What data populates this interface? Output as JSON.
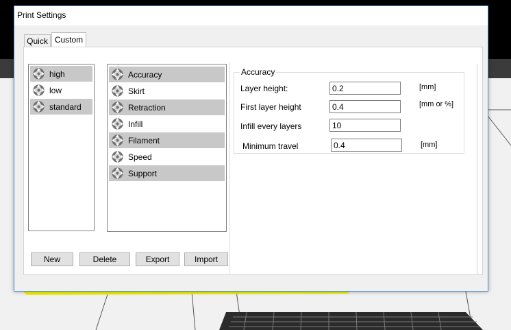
{
  "dialog": {
    "title": "Print Settings",
    "tabs": [
      {
        "label": "Quick",
        "selected": false
      },
      {
        "label": "Custom",
        "selected": true
      }
    ]
  },
  "profiles": [
    {
      "label": "high",
      "icon": "move-arrows-icon"
    },
    {
      "label": "low",
      "icon": "move-arrows-icon"
    },
    {
      "label": "standard",
      "icon": "move-arrows-icon"
    }
  ],
  "sections": [
    {
      "label": "Accuracy",
      "icon": "move-arrows-icon"
    },
    {
      "label": "Skirt",
      "icon": "move-arrows-icon"
    },
    {
      "label": "Retraction",
      "icon": "move-arrows-icon"
    },
    {
      "label": "Infill",
      "icon": "move-arrows-icon"
    },
    {
      "label": "Filament",
      "icon": "move-arrows-icon"
    },
    {
      "label": "Speed",
      "icon": "move-arrows-icon"
    },
    {
      "label": "Support",
      "icon": "move-arrows-icon"
    }
  ],
  "buttons": {
    "new": "New",
    "delete": "Delete",
    "export": "Export",
    "import": "Import"
  },
  "accuracy": {
    "legend": "Accuracy",
    "fields": [
      {
        "label": "Layer height:",
        "value": "0.2",
        "unit": "[mm]"
      },
      {
        "label": "First layer height",
        "value": "0.4",
        "unit": "[mm or %]"
      },
      {
        "label": "Infill every layers",
        "value": "10",
        "unit": ""
      },
      {
        "label": "Minimum travel",
        "value": "0.4",
        "unit": "[mm]"
      }
    ]
  },
  "colors": {
    "dialog_border": "#4a8fd6",
    "selected_item": "#c8c8c8",
    "highlight": "#f0f000"
  }
}
